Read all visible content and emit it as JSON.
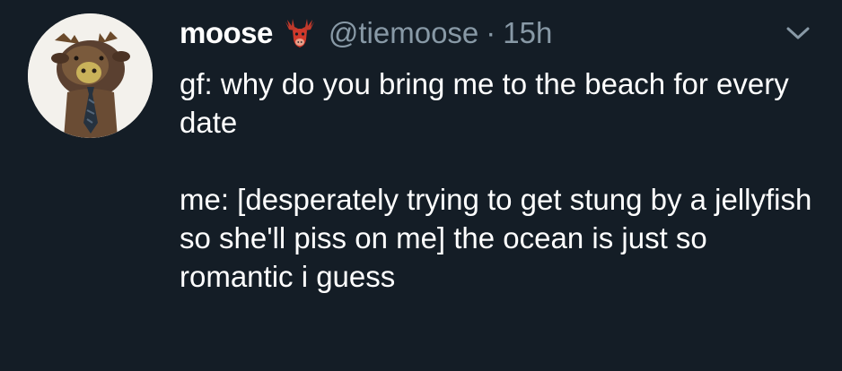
{
  "tweet": {
    "author": {
      "display_name": "moose",
      "handle": "@tiemoose",
      "emoji_icon": "moose-emoji-icon",
      "avatar_icon": "moose-with-tie-avatar"
    },
    "separator": "·",
    "timestamp": "15h",
    "menu_icon": "chevron-down-icon",
    "text_paragraphs": [
      "gf: why do you bring me to the beach for every date",
      "me: [desperately trying to get stung by a jellyfish so she'll piss on me] the ocean is just so romantic i guess"
    ]
  },
  "colors": {
    "background": "#141d26",
    "primary_text": "#ffffff",
    "secondary_text": "#8899a6",
    "emoji_red": "#d0392b"
  }
}
